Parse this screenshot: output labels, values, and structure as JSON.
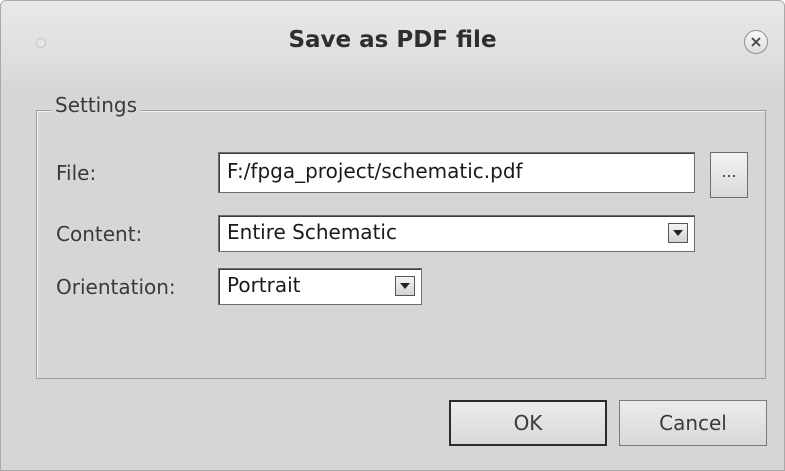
{
  "window": {
    "title": "Save as PDF file"
  },
  "settings": {
    "group_label": "Settings",
    "file_label": "File:",
    "file_value": "F:/fpga_project/schematic.pdf",
    "browse_label": "...",
    "content_label": "Content:",
    "content_value": "Entire Schematic",
    "orientation_label": "Orientation:",
    "orientation_value": "Portrait"
  },
  "buttons": {
    "ok": "OK",
    "cancel": "Cancel"
  },
  "icons": {
    "close": "close-icon",
    "dropdown": "chevron-down-icon",
    "window_menu": "window-menu-dot-icon"
  },
  "colors": {
    "dialog_bg": "#d6d6d6",
    "field_bg": "#ffffff",
    "text": "#3a3a3a"
  }
}
